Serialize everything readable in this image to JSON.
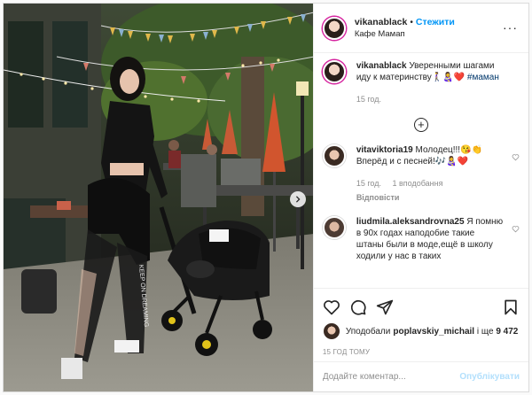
{
  "header": {
    "username": "vikanablack",
    "separator": "•",
    "follow_label": "Стежити",
    "location": "Кафе Мамап",
    "more_icon": "more-horizontal-icon"
  },
  "caption": {
    "username": "vikanablack",
    "text": "Уверенными шагами иду к материнству🚶‍♀️👩‍🍼❤️",
    "hashtag": "#маман",
    "time": "15 год."
  },
  "comments": [
    {
      "username": "vitaviktoria19",
      "text": "Молодец!!!😘👏 Вперёд и с песней!🎶👩‍🍼❤️",
      "time": "15 год.",
      "likes": "1 вподобання",
      "reply": "Відповісти"
    },
    {
      "username": "liudmila.aleksandrovna25",
      "text": "Я помню в 90х годах наподобие такие штаны были в моде,ещё в школу ходили у нас в таких",
      "time": "",
      "likes": "",
      "reply": ""
    }
  ],
  "likes": {
    "prefix": "Уподобали ",
    "user": "poplavskiy_michail",
    "middle": " і ще ",
    "count": "9 472"
  },
  "post_time": "15 ГОД ТОМУ",
  "add_comment": {
    "placeholder": "Додайте коментар...",
    "publish_label": "Опублікувати"
  },
  "colors": {
    "accent": "#0095f6",
    "publish_disabled": "#b2dffc",
    "text": "#262626",
    "muted": "#8e8e8e"
  }
}
